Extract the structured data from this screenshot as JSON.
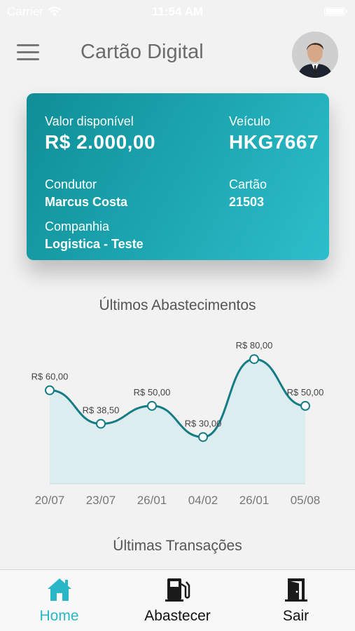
{
  "status_bar": {
    "carrier": "Carrier",
    "time": "11:54 AM"
  },
  "header": {
    "title": "Cartão Digital"
  },
  "card": {
    "available_label": "Valor disponível",
    "available_value": "R$ 2.000,00",
    "vehicle_label": "Veículo",
    "vehicle_value": "HKG7667",
    "driver_label": "Condutor",
    "driver_value": "Marcus Costa",
    "card_label": "Cartão",
    "card_value": "21503",
    "company_label": "Companhia",
    "company_value": "Logistica - Teste"
  },
  "sections": {
    "fuelings_title": "Últimos Abastecimentos",
    "transactions_title": "Últimas Transações"
  },
  "chart_data": {
    "type": "area",
    "categories": [
      "20/07",
      "23/07",
      "26/01",
      "04/02",
      "26/01",
      "05/08"
    ],
    "values": [
      60,
      38.5,
      50,
      30,
      80,
      50
    ],
    "data_labels": [
      "R$ 60,00",
      "R$ 38,50",
      "R$ 50,00",
      "R$ 30,00",
      "R$ 80,00",
      "R$ 50,00"
    ],
    "title": "Últimos Abastecimentos",
    "xlabel": "",
    "ylabel": "",
    "ylim": [
      0,
      90
    ],
    "grid": false,
    "colors": {
      "line": "#157c86",
      "fill": "#dcedef"
    }
  },
  "tabbar": {
    "items": [
      {
        "label": "Home",
        "icon": "home-icon",
        "active": true
      },
      {
        "label": "Abastecer",
        "icon": "fuel-pump-icon",
        "active": false
      },
      {
        "label": "Sair",
        "icon": "exit-door-icon",
        "active": false
      }
    ],
    "active_color": "#29b6c7",
    "inactive_color": "#111111"
  }
}
